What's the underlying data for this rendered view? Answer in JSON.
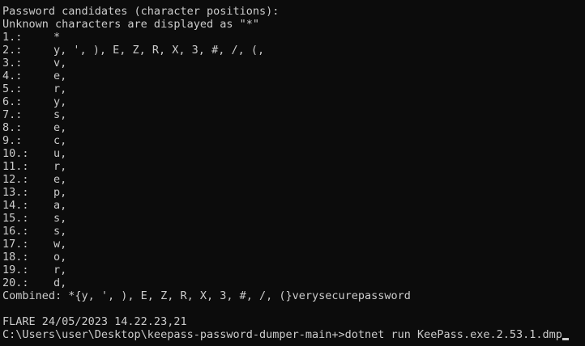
{
  "terminal": {
    "header": "Password candidates (character positions):",
    "unknown_note": "Unknown characters are displayed as \"*\"",
    "positions": [
      {
        "index": "1.:",
        "chars": "*"
      },
      {
        "index": "2.:",
        "chars": "y, ', ), E, Z, R, X, 3, #, /, (,"
      },
      {
        "index": "3.:",
        "chars": "v,"
      },
      {
        "index": "4.:",
        "chars": "e,"
      },
      {
        "index": "5.:",
        "chars": "r,"
      },
      {
        "index": "6.:",
        "chars": "y,"
      },
      {
        "index": "7.:",
        "chars": "s,"
      },
      {
        "index": "8.:",
        "chars": "e,"
      },
      {
        "index": "9.:",
        "chars": "c,"
      },
      {
        "index": "10.:",
        "chars": "u,"
      },
      {
        "index": "11.:",
        "chars": "r,"
      },
      {
        "index": "12.:",
        "chars": "e,"
      },
      {
        "index": "13.:",
        "chars": "p,"
      },
      {
        "index": "14.:",
        "chars": "a,"
      },
      {
        "index": "15.:",
        "chars": "s,"
      },
      {
        "index": "16.:",
        "chars": "s,"
      },
      {
        "index": "17.:",
        "chars": "w,"
      },
      {
        "index": "18.:",
        "chars": "o,"
      },
      {
        "index": "19.:",
        "chars": "r,"
      },
      {
        "index": "20.:",
        "chars": "d,"
      }
    ],
    "combined": "Combined: *{y, ', ), E, Z, R, X, 3, #, /, (}verysecurepassword",
    "host_timestamp": "FLARE 24/05/2023 14.22.23,21",
    "prompt_path": "C:\\Users\\user\\Desktop\\keepass-password-dumper-main+>",
    "prompt_command": "dotnet run KeePass.exe.2.53.1.dmp",
    "colors": {
      "background": "#0c0c0c",
      "foreground": "#cccccc"
    }
  }
}
